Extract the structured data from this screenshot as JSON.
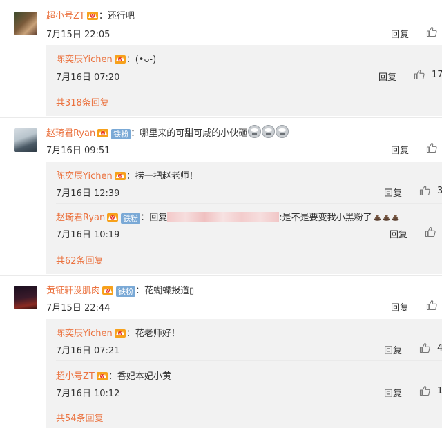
{
  "comments": [
    {
      "name": "超小号ZT",
      "text": "：还行吧",
      "time": "7月15日 22:05",
      "reply": "回复",
      "replies": [
        {
          "name": "陈奕辰Yichen",
          "text": "：(•ᴗ-)",
          "time": "7月16日 07:20",
          "reply": "回复",
          "likes": "17"
        }
      ],
      "more": "共318条回复"
    },
    {
      "name": "赵琦君Ryan",
      "badge": "铁粉",
      "text": "：哪里来的可甜可咸的小伙砸",
      "time": "7月16日 09:51",
      "reply": "回复",
      "replies": [
        {
          "name": "陈奕辰Yichen",
          "text": "：捞一把赵老师！",
          "time": "7月16日 12:39",
          "reply": "回复",
          "likes": "3"
        },
        {
          "name": "赵琦君Ryan",
          "badge": "铁粉",
          "text_prefix": "：回复",
          "text": ":是不是要变我小黑粉了",
          "time": "7月16日 10:19",
          "reply": "回复"
        }
      ],
      "more": "共62条回复"
    },
    {
      "name": "黄钲轩没肌肉",
      "badge": "铁粉",
      "text": "：花蝴蝶报道▯",
      "time": "7月15日 22:44",
      "reply": "回复",
      "replies": [
        {
          "name": "陈奕辰Yichen",
          "text": "：花老师好！",
          "time": "7月16日 07:21",
          "reply": "回复",
          "likes": "4"
        },
        {
          "name": "超小号ZT",
          "text": "：香妃本妃小黄",
          "time": "7月16日 10:12",
          "reply": "回复",
          "likes": "1"
        }
      ],
      "more": "共54条回复"
    }
  ],
  "icons": {
    "like": "thumbs-up-icon",
    "member": "vip-crown-icon",
    "emoji": "ultraman-emoji-icon",
    "poop": "poop-emoji-icon"
  },
  "colors": {
    "name": "#eb7340",
    "badge": "#7aa9d6",
    "sub_bg": "#f2f2f2"
  }
}
